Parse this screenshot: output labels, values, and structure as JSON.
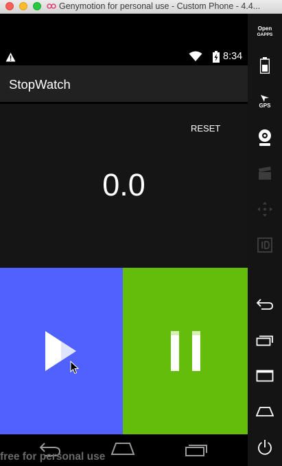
{
  "window": {
    "title": "Genymotion for personal use - Custom Phone - 4.4..."
  },
  "statusbar": {
    "time": "8:34"
  },
  "app": {
    "title": "StopWatch"
  },
  "stopwatch": {
    "reset_label": "RESET",
    "time": "0.0"
  },
  "buttons": {
    "start_icon": "play-icon",
    "pause_icon": "pause-icon"
  },
  "colors": {
    "start": "#5161fd",
    "pause": "#63bd0a",
    "display_bg": "#151515",
    "actionbar_bg": "#212121"
  },
  "watermark": "free for personal use",
  "sidebar": {
    "opengapps_line1": "Open",
    "opengapps_line2": "GAPPS",
    "gps_label": "GPS"
  }
}
